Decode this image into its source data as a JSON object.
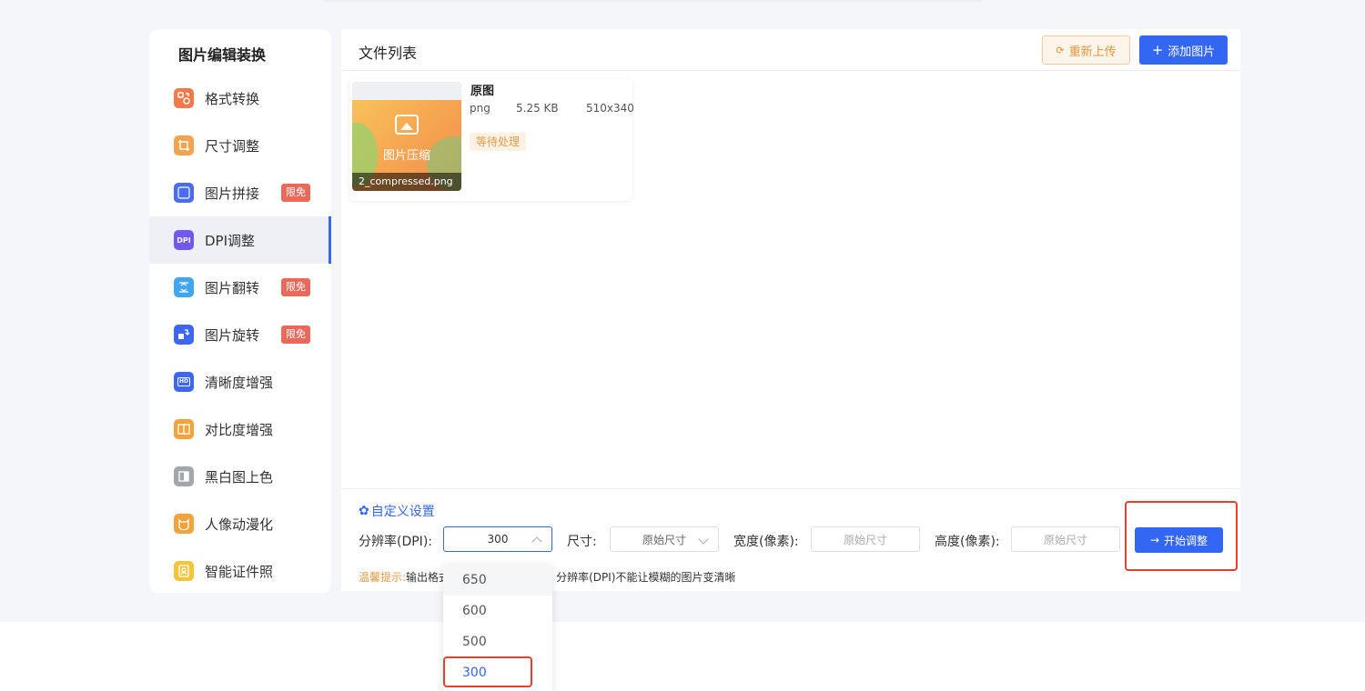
{
  "sidebar": {
    "title": "图片编辑装换",
    "items": [
      {
        "label": "格式转换",
        "icon": "format-convert-icon",
        "color": "#f07a4c"
      },
      {
        "label": "尺寸调整",
        "icon": "crop-icon",
        "color": "#f0a54e"
      },
      {
        "label": "图片拼接",
        "icon": "stitch-icon",
        "color": "#4a6cf2",
        "badge": "限免"
      },
      {
        "label": "DPI调整",
        "icon": "dpi-icon",
        "color": "#7358f0",
        "icon_text": "DPI"
      },
      {
        "label": "图片翻转",
        "icon": "flip-icon",
        "color": "#3fa6ef",
        "badge": "限免"
      },
      {
        "label": "图片旋转",
        "icon": "rotate-icon",
        "color": "#3d67f1",
        "badge": "限免"
      },
      {
        "label": "清晰度增强",
        "icon": "hd-icon",
        "color": "#3d67f1",
        "icon_text": "HD"
      },
      {
        "label": "对比度增强",
        "icon": "contrast-icon",
        "color": "#f2a33b"
      },
      {
        "label": "黑白图上色",
        "icon": "colorize-icon",
        "color": "#a2a6ad"
      },
      {
        "label": "人像动漫化",
        "icon": "cartoon-icon",
        "color": "#f2a33b"
      },
      {
        "label": "智能证件照",
        "icon": "id-photo-icon",
        "color": "#f4c43a"
      }
    ],
    "active_index": 3
  },
  "main": {
    "title": "文件列表",
    "reupload_label": "重新上传",
    "add_label": "添加图片",
    "file": {
      "thumb_caption": "图片压缩",
      "filename": "2_compressed.png",
      "meta_title": "原图",
      "format": "png",
      "size": "5.25 KB",
      "dimensions": "510x340",
      "status": "等待处理"
    }
  },
  "settings": {
    "title": "自定义设置",
    "dpi_label": "分辨率(DPI):",
    "dpi_value": "300",
    "size_label": "尺寸:",
    "size_value": "原始尺寸",
    "width_label": "宽度(像素):",
    "width_placeholder": "原始尺寸",
    "height_label": "高度(像素):",
    "height_placeholder": "原始尺寸",
    "start_label": "开始调整",
    "tip_label": "温馨提示:",
    "tip_text": "输出格式",
    "tip_text_2": "分辨率(DPI)不能让模糊的图片变清晰"
  },
  "dpi_dropdown": {
    "options": [
      "650",
      "600",
      "500",
      "300"
    ],
    "selected": "300"
  },
  "colors": {
    "accent": "#3367f3",
    "warning": "#e99a49",
    "badge": "#e96a5a",
    "highlight_box": "#e0442e"
  }
}
